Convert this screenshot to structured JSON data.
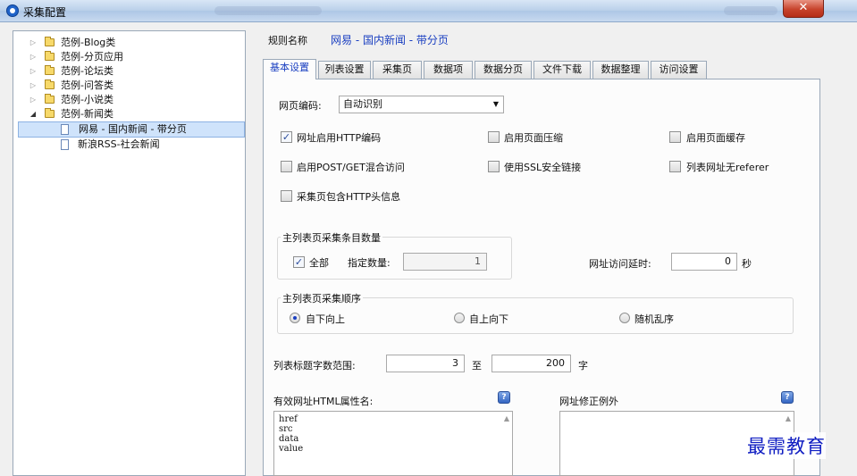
{
  "window": {
    "title": "采集配置",
    "close_label": "✕"
  },
  "tree": {
    "items": [
      {
        "label": "范例-Blog类"
      },
      {
        "label": "范例-分页应用"
      },
      {
        "label": "范例-论坛类"
      },
      {
        "label": "范例-问答类"
      },
      {
        "label": "范例-小说类"
      },
      {
        "label": "范例-新闻类"
      },
      {
        "label": "网易 - 国内新闻 - 带分页"
      },
      {
        "label": "新浪RSS-社会新闻"
      }
    ]
  },
  "rule": {
    "label": "规则名称",
    "value": "网易 - 国内新闻 - 带分页"
  },
  "tabs": [
    "基本设置",
    "列表设置",
    "采集页",
    "数据项",
    "数据分页",
    "文件下载",
    "数据整理",
    "访问设置"
  ],
  "encoding": {
    "label": "网页编码:",
    "value": "自动识别"
  },
  "options": [
    {
      "label": "网址启用HTTP编码",
      "checked": true
    },
    {
      "label": "启用页面压缩",
      "checked": false
    },
    {
      "label": "启用页面缓存",
      "checked": false
    },
    {
      "label": "启用POST/GET混合访问",
      "checked": false
    },
    {
      "label": "使用SSL安全链接",
      "checked": false
    },
    {
      "label": "列表网址无referer",
      "checked": false
    },
    {
      "label": "采集页包含HTTP头信息",
      "checked": false
    }
  ],
  "count_group": {
    "title": "主列表页采集条目数量",
    "all_label": "全部",
    "all_checked": true,
    "specify_label": "指定数量:",
    "specify_value": "1"
  },
  "delay": {
    "label": "网址访问延时:",
    "value": "0",
    "unit": "秒"
  },
  "order_group": {
    "title": "主列表页采集顺序",
    "options": [
      {
        "label": "自下向上",
        "checked": true
      },
      {
        "label": "自上向下",
        "checked": false
      },
      {
        "label": "随机乱序",
        "checked": false
      }
    ]
  },
  "title_length": {
    "label": "列表标题字数范围:",
    "min": "3",
    "to": "至",
    "max": "200",
    "unit": "字"
  },
  "html_attrs": {
    "label": "有效网址HTML属性名:",
    "lines": [
      "href",
      "src",
      "data",
      "value"
    ]
  },
  "url_exceptions": {
    "label": "网址修正例外"
  },
  "watermark": "最需教育"
}
